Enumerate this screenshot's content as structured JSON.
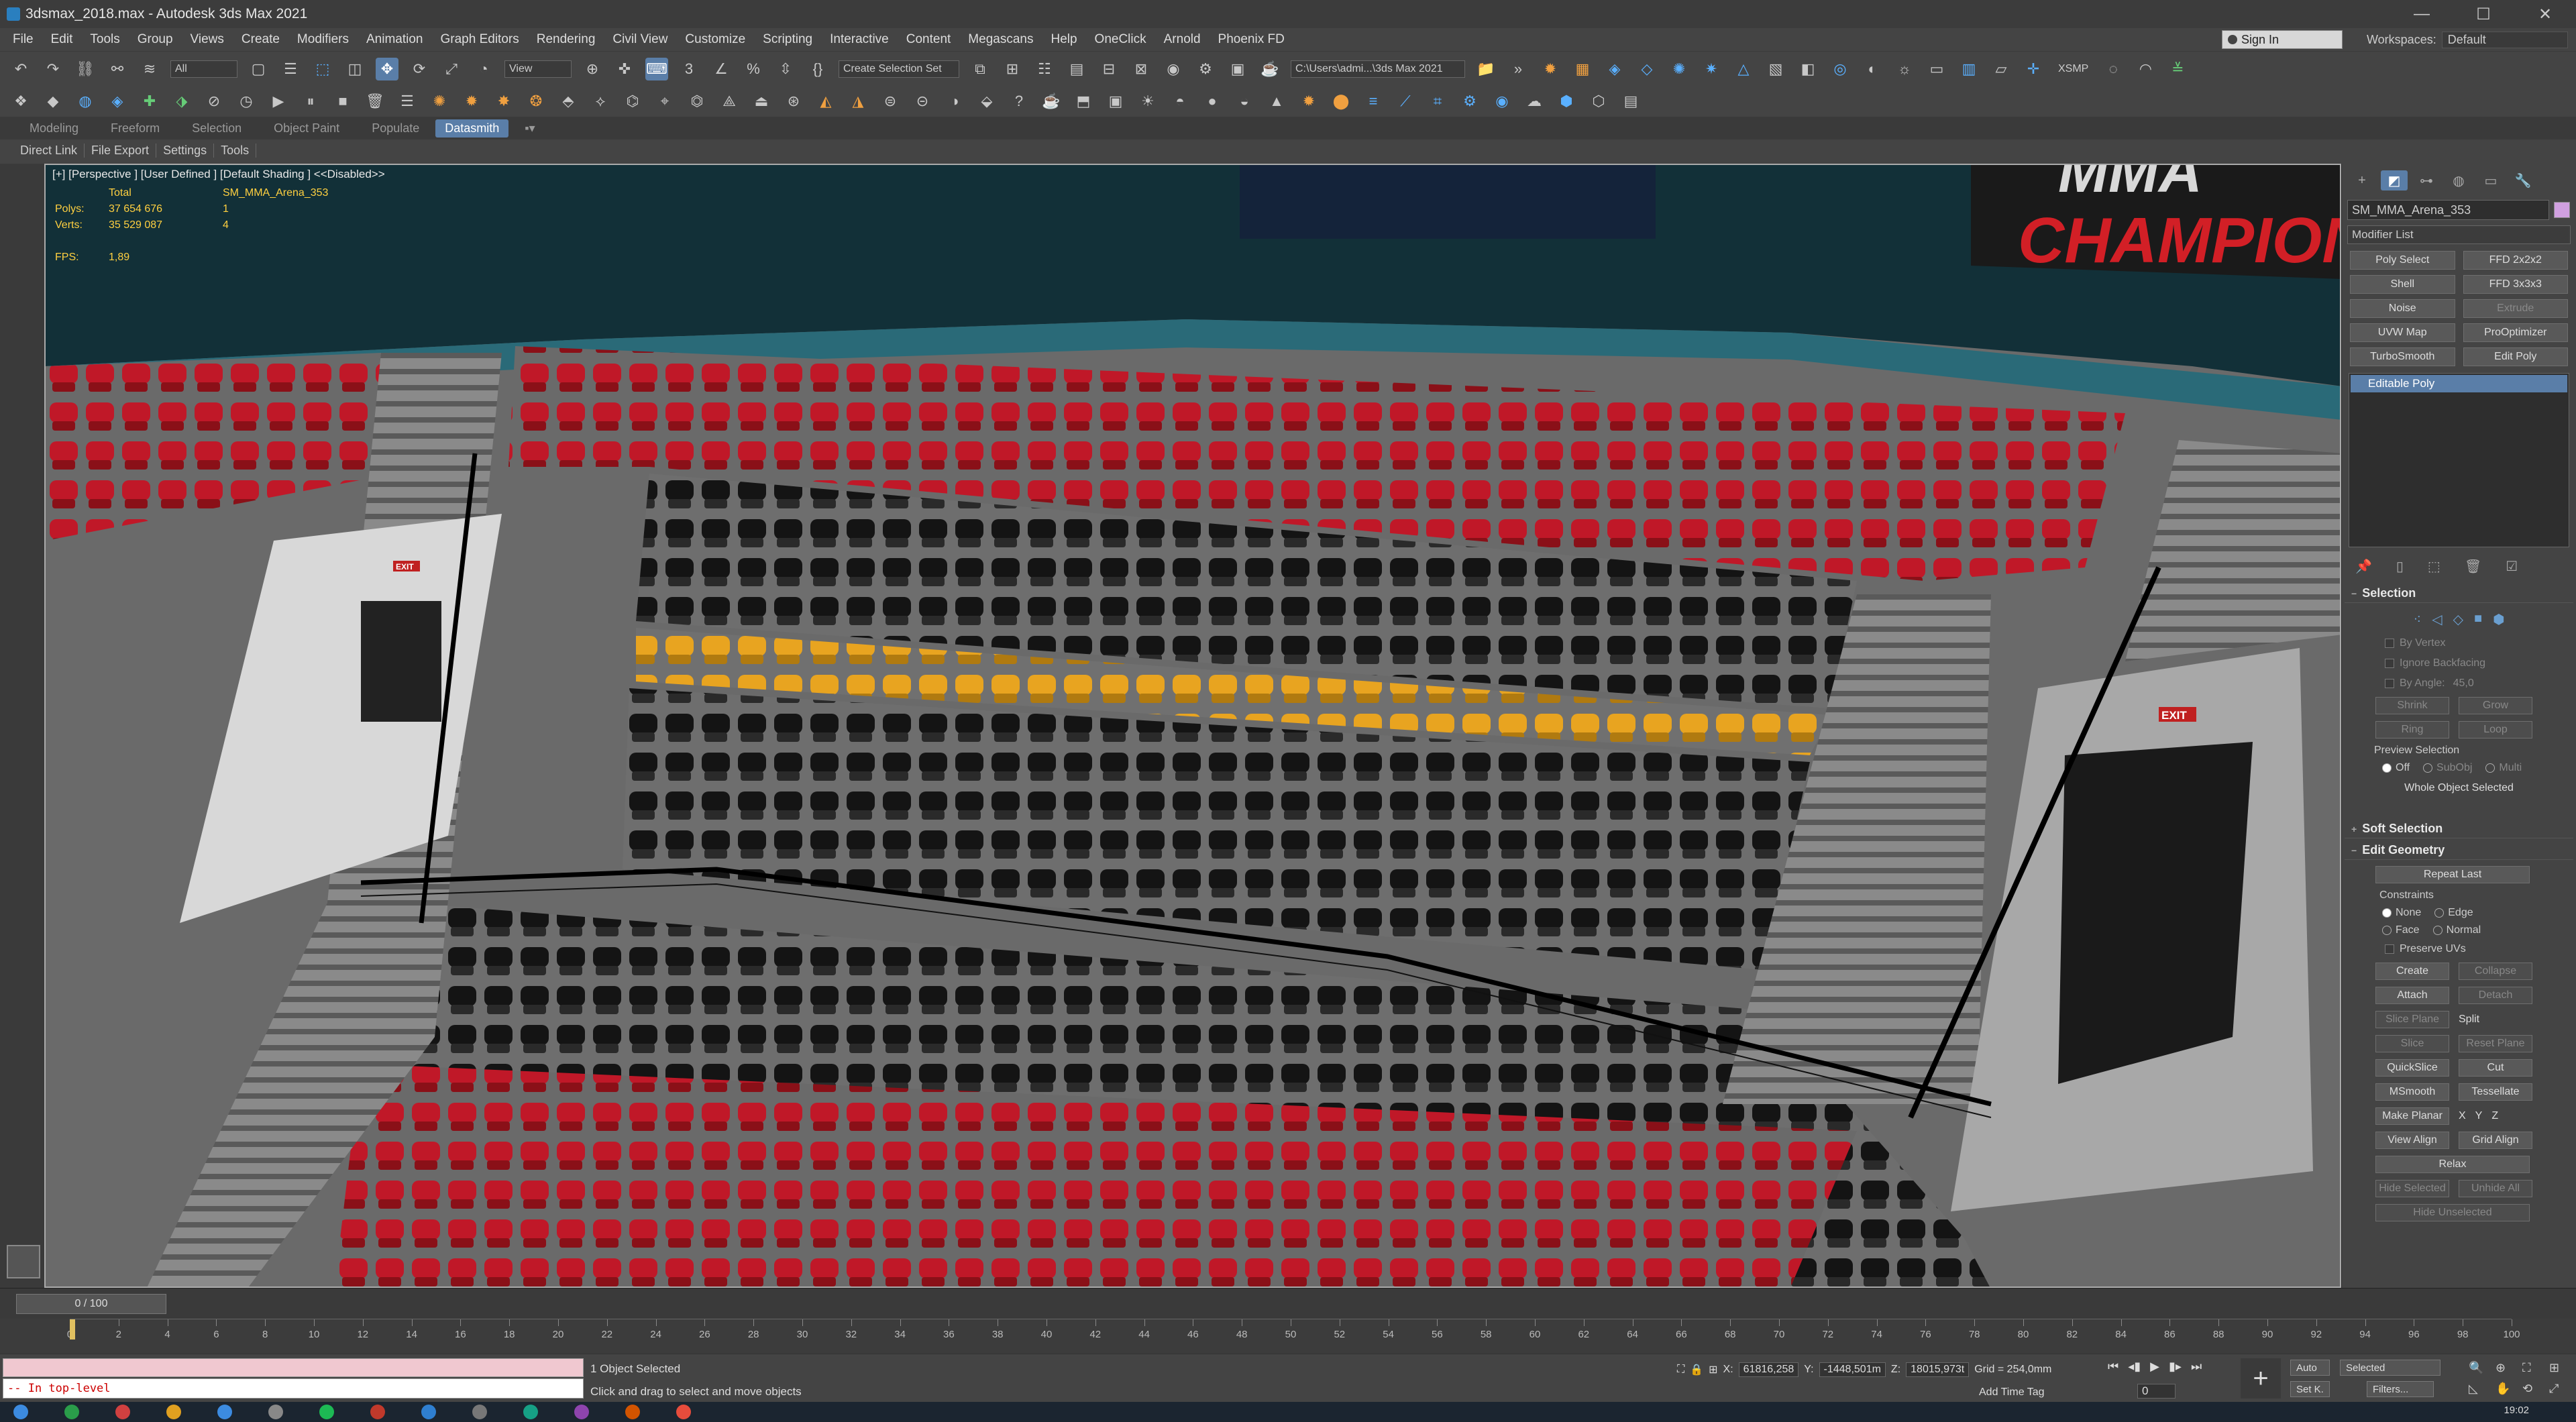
{
  "window": {
    "title": "3dsmax_2018.max - Autodesk 3ds Max 2021",
    "buttons": [
      "—",
      "☐",
      "✕"
    ]
  },
  "menu": [
    "File",
    "Edit",
    "Tools",
    "Group",
    "Views",
    "Create",
    "Modifiers",
    "Animation",
    "Graph Editors",
    "Rendering",
    "Civil View",
    "Customize",
    "Scripting",
    "Interactive",
    "Content",
    "Megascans",
    "Help",
    "OneClick",
    "Arnold",
    "Phoenix FD"
  ],
  "signin": "Sign In",
  "workspaces": {
    "label": "Workspaces:",
    "value": "Default"
  },
  "toolbar1": {
    "filter": "All",
    "refcoord": "View",
    "selset": "Create Selection Set",
    "path": "C:\\Users\\admi...\\3ds Max 2021",
    "xsmp": "XSMP"
  },
  "ribbon": {
    "tabs": [
      "Modeling",
      "Freeform",
      "Selection",
      "Object Paint",
      "Populate",
      "Datasmith"
    ],
    "active": "Datasmith"
  },
  "subtabs": [
    "Direct Link",
    "File Export",
    "Settings",
    "Tools"
  ],
  "viewport": {
    "label": "[+] [Perspective ] [User Defined ] [Default Shading ] <<Disabled>>",
    "stats": {
      "col_total": "Total",
      "col_obj": "SM_MMA_Arena_353",
      "polys_label": "Polys:",
      "polys_total": "37 654 676",
      "polys_obj": "1",
      "verts_label": "Verts:",
      "verts_total": "35 529 087",
      "verts_obj": "4",
      "fps_label": "FPS:",
      "fps": "1,89"
    },
    "signs": {
      "champion": "CHAMPION",
      "mma": "MMA",
      "exit": "EXIT"
    }
  },
  "command_panel": {
    "object_name": "SM_MMA_Arena_353",
    "object_color": "#d0a0e0",
    "modifier_list": "Modifier List",
    "modifiers": [
      "Poly Select",
      "FFD 2x2x2",
      "Shell",
      "FFD 3x3x3",
      "Noise",
      "Extrude",
      "UVW Map",
      "ProOptimizer",
      "TurboSmooth",
      "Edit Poly"
    ],
    "stack_item": "Editable Poly",
    "selection": {
      "title": "Selection",
      "by_vertex": "By Vertex",
      "ignore_backfacing": "Ignore Backfacing",
      "by_angle": "By Angle:",
      "angle": "45,0",
      "shrink": "Shrink",
      "grow": "Grow",
      "ring": "Ring",
      "loop": "Loop",
      "preview": "Preview Selection",
      "off": "Off",
      "subobj": "SubObj",
      "multi": "Multi",
      "whole": "Whole Object Selected"
    },
    "soft_selection": "Soft Selection",
    "edit_geometry": {
      "title": "Edit Geometry",
      "repeat_last": "Repeat Last",
      "constraints": "Constraints",
      "none": "None",
      "edge": "Edge",
      "face": "Face",
      "normal": "Normal",
      "preserve_uvs": "Preserve UVs",
      "create": "Create",
      "collapse": "Collapse",
      "attach": "Attach",
      "detach": "Detach",
      "slice_plane": "Slice Plane",
      "split": "Split",
      "slice": "Slice",
      "reset_plane": "Reset Plane",
      "quickslice": "QuickSlice",
      "cut": "Cut",
      "msmooth": "MSmooth",
      "tessellate": "Tessellate",
      "make_planar": "Make Planar",
      "x": "X",
      "y": "Y",
      "z": "Z",
      "view_align": "View Align",
      "grid_align": "Grid Align",
      "relax": "Relax",
      "hide_selected": "Hide Selected",
      "unhide_all": "Unhide All",
      "hide_unselected": "Hide Unselected"
    }
  },
  "timeline": {
    "slider": "0 / 100",
    "ticks": [
      "0",
      "2",
      "4",
      "6",
      "8",
      "10",
      "12",
      "14",
      "16",
      "18",
      "20",
      "22",
      "24",
      "26",
      "28",
      "30",
      "32",
      "34",
      "36",
      "38",
      "40",
      "42",
      "44",
      "46",
      "48",
      "50",
      "52",
      "54",
      "56",
      "58",
      "60",
      "62",
      "64",
      "66",
      "68",
      "70",
      "72",
      "74",
      "76",
      "78",
      "80",
      "82",
      "84",
      "86",
      "88",
      "90",
      "92",
      "94",
      "96",
      "98",
      "100"
    ]
  },
  "status": {
    "maxscript": "-- In top-level",
    "selected": "1 Object Selected",
    "prompt": "Click and drag to select and move objects",
    "x_label": "X:",
    "x": "61816,258",
    "y_label": "Y:",
    "y": "-1448,501m",
    "z_label": "Z:",
    "z": "18015,973t",
    "grid": "Grid = 254,0mm",
    "add_time_tag": "Add Time Tag",
    "auto": "Auto",
    "setk": "Set K.",
    "selected_dd": "Selected",
    "filters": "Filters...",
    "frame": "0",
    "clock": "19:02"
  }
}
